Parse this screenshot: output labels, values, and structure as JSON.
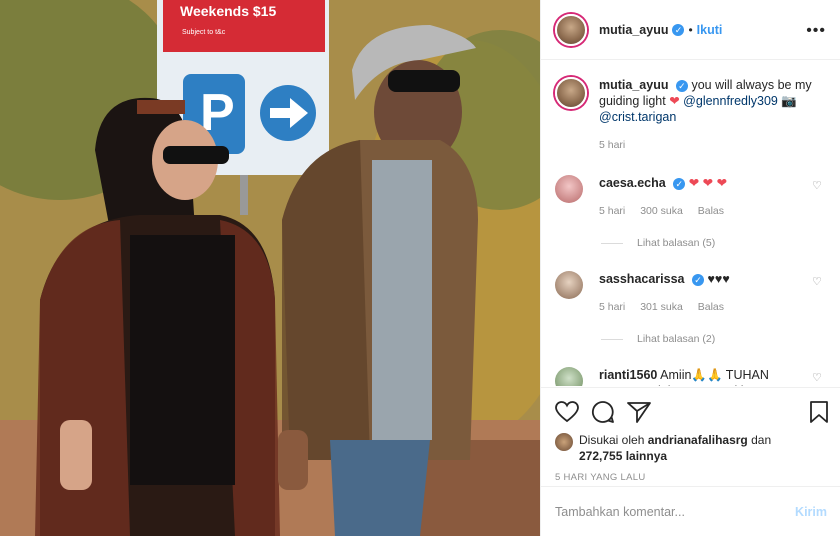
{
  "photo": {
    "sign_text": "Weekends  $15",
    "sign_subtext": "Subject to t&c",
    "parking_letter": "P"
  },
  "header": {
    "username": "mutia_ayuu",
    "follow_label": "Ikuti",
    "more_label": "•••"
  },
  "caption": {
    "username": "mutia_ayuu",
    "text": "you will always be my guiding light",
    "mention1": "@glennfredly309",
    "mention2": "@crist.tarigan",
    "time": "5 hari"
  },
  "comments": [
    {
      "username": "caesa.echa",
      "text": "",
      "time": "5 hari",
      "likes": "300 suka",
      "reply": "Balas",
      "replies": "Lihat balasan (5)"
    },
    {
      "username": "sasshacarissa",
      "text": "♥♥♥",
      "time": "5 hari",
      "likes": "301 suka",
      "reply": "Balas",
      "replies": "Lihat balasan (2)"
    },
    {
      "username": "rianti1560",
      "text": "Amiin🙏🙏 TUHAN YESUS selalu Bersama kita"
    }
  ],
  "likes": {
    "prefix": "Disukai oleh",
    "user": "andrianafalihasrg",
    "connector": "dan",
    "count": "272,755 lainnya"
  },
  "date": "5 HARI YANG LALU",
  "add_comment": {
    "placeholder": "Tambahkan komentar...",
    "post_label": "Kirim"
  }
}
